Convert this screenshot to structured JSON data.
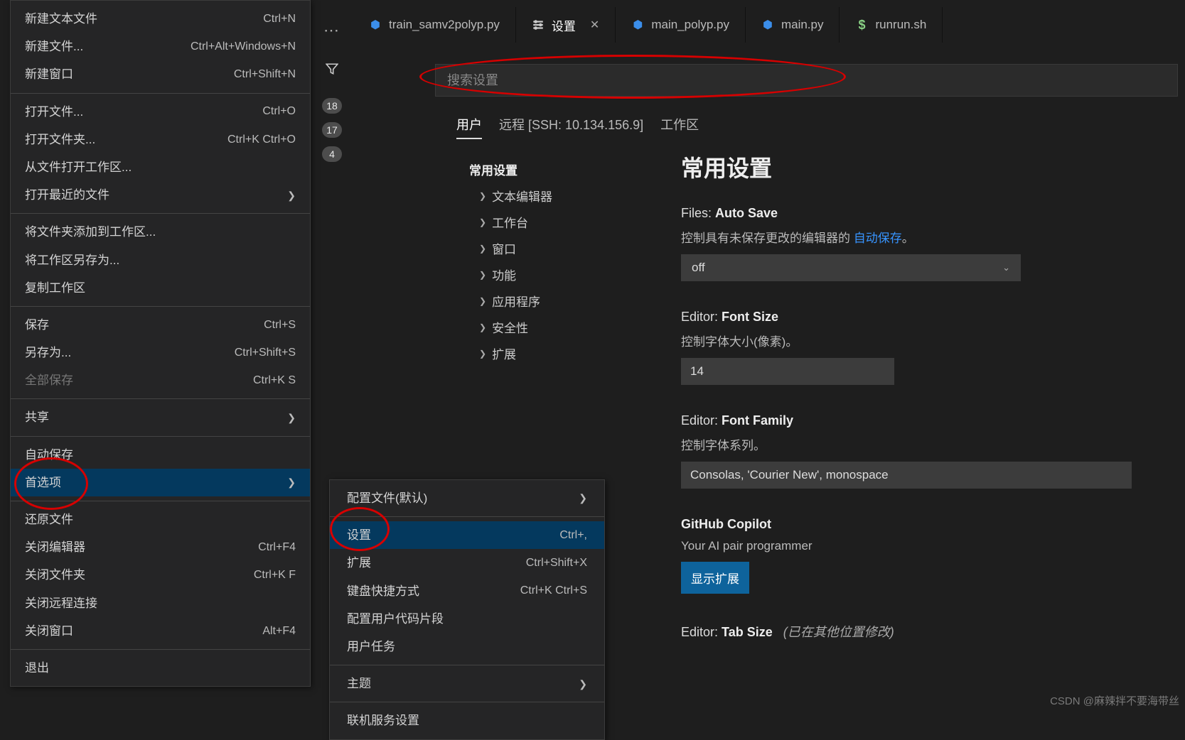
{
  "fileMenu": {
    "newTextFile": {
      "label": "新建文本文件",
      "accel": "Ctrl+N"
    },
    "newFile": {
      "label": "新建文件...",
      "accel": "Ctrl+Alt+Windows+N"
    },
    "newWindow": {
      "label": "新建窗口",
      "accel": "Ctrl+Shift+N"
    },
    "openFile": {
      "label": "打开文件...",
      "accel": "Ctrl+O"
    },
    "openFolder": {
      "label": "打开文件夹...",
      "accel": "Ctrl+K Ctrl+O"
    },
    "openWorkspace": {
      "label": "从文件打开工作区..."
    },
    "openRecent": {
      "label": "打开最近的文件"
    },
    "addFolder": {
      "label": "将文件夹添加到工作区..."
    },
    "saveWSAs": {
      "label": "将工作区另存为..."
    },
    "dupWS": {
      "label": "复制工作区"
    },
    "save": {
      "label": "保存",
      "accel": "Ctrl+S"
    },
    "saveAs": {
      "label": "另存为...",
      "accel": "Ctrl+Shift+S"
    },
    "saveAll": {
      "label": "全部保存",
      "accel": "Ctrl+K S"
    },
    "share": {
      "label": "共享"
    },
    "autoSave": {
      "label": "自动保存"
    },
    "preferences": {
      "label": "首选项"
    },
    "revert": {
      "label": "还原文件"
    },
    "closeEditor": {
      "label": "关闭编辑器",
      "accel": "Ctrl+F4"
    },
    "closeFolder": {
      "label": "关闭文件夹",
      "accel": "Ctrl+K F"
    },
    "closeRemote": {
      "label": "关闭远程连接"
    },
    "closeWindow": {
      "label": "关闭窗口",
      "accel": "Alt+F4"
    },
    "exit": {
      "label": "退出"
    }
  },
  "submenu": {
    "profiles": {
      "label": "配置文件(默认)"
    },
    "settings": {
      "label": "设置",
      "accel": "Ctrl+,"
    },
    "extensions": {
      "label": "扩展",
      "accel": "Ctrl+Shift+X"
    },
    "kbShortcuts": {
      "label": "键盘快捷方式",
      "accel": "Ctrl+K Ctrl+S"
    },
    "snippets": {
      "label": "配置用户代码片段"
    },
    "tasks": {
      "label": "用户任务"
    },
    "theme": {
      "label": "主题"
    },
    "online": {
      "label": "联机服务设置"
    }
  },
  "toolbar": {
    "badge1": "18",
    "badge2": "17",
    "badge3": "4"
  },
  "tabs": {
    "t1": "train_samv2polyp.py",
    "t2": "设置",
    "t3": "main_polyp.py",
    "t4": "main.py",
    "t5": "runrun.sh"
  },
  "search": {
    "placeholder": "搜索设置"
  },
  "scope": {
    "user": "用户",
    "remote": "远程 [SSH: 10.134.156.9]",
    "workspace": "工作区"
  },
  "side": {
    "common": "常用设置",
    "textEditor": "文本编辑器",
    "workbench": "工作台",
    "window": "窗口",
    "features": "功能",
    "application": "应用程序",
    "security": "安全性",
    "extensions": "扩展"
  },
  "content": {
    "heading": "常用设置",
    "autoSave": {
      "title_pre": "Files: ",
      "title_bold": "Auto Save",
      "desc_pre": "控制具有未保存更改的编辑器的 ",
      "link": "自动保存",
      "desc_post": "。",
      "value": "off"
    },
    "fontSize": {
      "title_pre": "Editor: ",
      "title_bold": "Font Size",
      "desc": "控制字体大小(像素)。",
      "value": "14"
    },
    "fontFamily": {
      "title_pre": "Editor: ",
      "title_bold": "Font Family",
      "desc": "控制字体系列。",
      "value": "Consolas, 'Courier New', monospace"
    },
    "copilot": {
      "title": "GitHub Copilot",
      "desc": "Your AI pair programmer",
      "button": "显示扩展"
    },
    "tabSize": {
      "title_pre": "Editor: ",
      "title_bold": "Tab Size",
      "note": "(已在其他位置修改)"
    }
  },
  "watermark": "CSDN @麻辣拌不要海带丝"
}
